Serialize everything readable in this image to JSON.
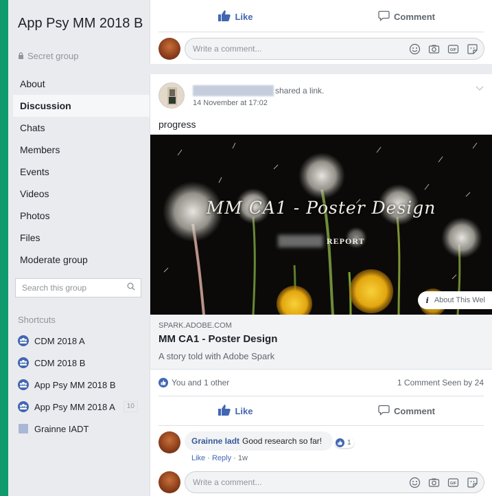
{
  "sidebar": {
    "group_name": "App Psy MM 2018 B",
    "privacy": "Secret group",
    "nav": [
      {
        "label": "About"
      },
      {
        "label": "Discussion",
        "active": true
      },
      {
        "label": "Chats"
      },
      {
        "label": "Members"
      },
      {
        "label": "Events"
      },
      {
        "label": "Videos"
      },
      {
        "label": "Photos"
      },
      {
        "label": "Files"
      },
      {
        "label": "Moderate group"
      }
    ],
    "search_placeholder": "Search this group",
    "shortcuts_title": "Shortcuts",
    "shortcuts": [
      {
        "label": "CDM 2018 A",
        "icon": "group-icon"
      },
      {
        "label": "CDM 2018 B",
        "icon": "group-icon"
      },
      {
        "label": "App Psy MM 2018 B",
        "icon": "group-icon"
      },
      {
        "label": "App Psy MM 2018 A",
        "icon": "group-icon",
        "badge": "10"
      },
      {
        "label": "Grainne IADT",
        "icon": "page-icon"
      }
    ]
  },
  "previous_post": {
    "like_label": "Like",
    "comment_label": "Comment",
    "comment_placeholder": "Write a comment..."
  },
  "post": {
    "action_text": "shared a link.",
    "time": "14 November at 17:02",
    "text": "progress",
    "image": {
      "title": "MM CA1 - Poster Design",
      "subtitle": "REPORT",
      "about_label": "About This Wel"
    },
    "link": {
      "domain": "SPARK.ADOBE.COM",
      "title": "MM CA1 - Poster Design",
      "description": "A story told with Adobe Spark"
    },
    "reactions_text": "You and 1 other",
    "stats_text": "1 Comment Seen by 24",
    "like_label": "Like",
    "comment_label": "Comment",
    "comment": {
      "author": "Grainne Iadt",
      "text": "Good research so far!",
      "like_count": "1",
      "like_action": "Like",
      "reply_action": "Reply",
      "age": "1w"
    },
    "comment_placeholder": "Write a comment..."
  },
  "colors": {
    "outer_background": "#0f9a6e",
    "facebook_blue": "#4267b2",
    "page_background": "#e9ebee"
  }
}
